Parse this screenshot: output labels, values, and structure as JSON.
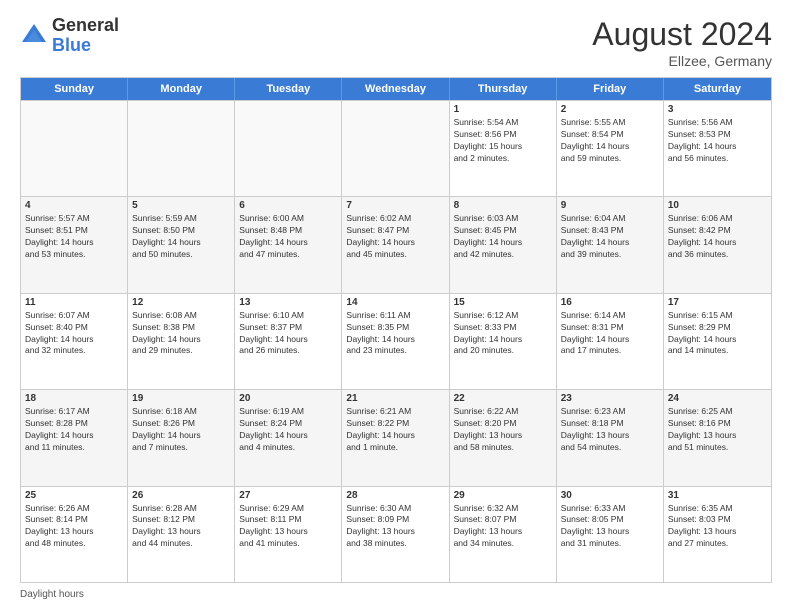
{
  "logo": {
    "general": "General",
    "blue": "Blue"
  },
  "title": "August 2024",
  "location": "Ellzee, Germany",
  "footer": "Daylight hours",
  "days_of_week": [
    "Sunday",
    "Monday",
    "Tuesday",
    "Wednesday",
    "Thursday",
    "Friday",
    "Saturday"
  ],
  "weeks": [
    [
      {
        "num": "",
        "info": ""
      },
      {
        "num": "",
        "info": ""
      },
      {
        "num": "",
        "info": ""
      },
      {
        "num": "",
        "info": ""
      },
      {
        "num": "1",
        "info": "Sunrise: 5:54 AM\nSunset: 8:56 PM\nDaylight: 15 hours\nand 2 minutes."
      },
      {
        "num": "2",
        "info": "Sunrise: 5:55 AM\nSunset: 8:54 PM\nDaylight: 14 hours\nand 59 minutes."
      },
      {
        "num": "3",
        "info": "Sunrise: 5:56 AM\nSunset: 8:53 PM\nDaylight: 14 hours\nand 56 minutes."
      }
    ],
    [
      {
        "num": "4",
        "info": "Sunrise: 5:57 AM\nSunset: 8:51 PM\nDaylight: 14 hours\nand 53 minutes."
      },
      {
        "num": "5",
        "info": "Sunrise: 5:59 AM\nSunset: 8:50 PM\nDaylight: 14 hours\nand 50 minutes."
      },
      {
        "num": "6",
        "info": "Sunrise: 6:00 AM\nSunset: 8:48 PM\nDaylight: 14 hours\nand 47 minutes."
      },
      {
        "num": "7",
        "info": "Sunrise: 6:02 AM\nSunset: 8:47 PM\nDaylight: 14 hours\nand 45 minutes."
      },
      {
        "num": "8",
        "info": "Sunrise: 6:03 AM\nSunset: 8:45 PM\nDaylight: 14 hours\nand 42 minutes."
      },
      {
        "num": "9",
        "info": "Sunrise: 6:04 AM\nSunset: 8:43 PM\nDaylight: 14 hours\nand 39 minutes."
      },
      {
        "num": "10",
        "info": "Sunrise: 6:06 AM\nSunset: 8:42 PM\nDaylight: 14 hours\nand 36 minutes."
      }
    ],
    [
      {
        "num": "11",
        "info": "Sunrise: 6:07 AM\nSunset: 8:40 PM\nDaylight: 14 hours\nand 32 minutes."
      },
      {
        "num": "12",
        "info": "Sunrise: 6:08 AM\nSunset: 8:38 PM\nDaylight: 14 hours\nand 29 minutes."
      },
      {
        "num": "13",
        "info": "Sunrise: 6:10 AM\nSunset: 8:37 PM\nDaylight: 14 hours\nand 26 minutes."
      },
      {
        "num": "14",
        "info": "Sunrise: 6:11 AM\nSunset: 8:35 PM\nDaylight: 14 hours\nand 23 minutes."
      },
      {
        "num": "15",
        "info": "Sunrise: 6:12 AM\nSunset: 8:33 PM\nDaylight: 14 hours\nand 20 minutes."
      },
      {
        "num": "16",
        "info": "Sunrise: 6:14 AM\nSunset: 8:31 PM\nDaylight: 14 hours\nand 17 minutes."
      },
      {
        "num": "17",
        "info": "Sunrise: 6:15 AM\nSunset: 8:29 PM\nDaylight: 14 hours\nand 14 minutes."
      }
    ],
    [
      {
        "num": "18",
        "info": "Sunrise: 6:17 AM\nSunset: 8:28 PM\nDaylight: 14 hours\nand 11 minutes."
      },
      {
        "num": "19",
        "info": "Sunrise: 6:18 AM\nSunset: 8:26 PM\nDaylight: 14 hours\nand 7 minutes."
      },
      {
        "num": "20",
        "info": "Sunrise: 6:19 AM\nSunset: 8:24 PM\nDaylight: 14 hours\nand 4 minutes."
      },
      {
        "num": "21",
        "info": "Sunrise: 6:21 AM\nSunset: 8:22 PM\nDaylight: 14 hours\nand 1 minute."
      },
      {
        "num": "22",
        "info": "Sunrise: 6:22 AM\nSunset: 8:20 PM\nDaylight: 13 hours\nand 58 minutes."
      },
      {
        "num": "23",
        "info": "Sunrise: 6:23 AM\nSunset: 8:18 PM\nDaylight: 13 hours\nand 54 minutes."
      },
      {
        "num": "24",
        "info": "Sunrise: 6:25 AM\nSunset: 8:16 PM\nDaylight: 13 hours\nand 51 minutes."
      }
    ],
    [
      {
        "num": "25",
        "info": "Sunrise: 6:26 AM\nSunset: 8:14 PM\nDaylight: 13 hours\nand 48 minutes."
      },
      {
        "num": "26",
        "info": "Sunrise: 6:28 AM\nSunset: 8:12 PM\nDaylight: 13 hours\nand 44 minutes."
      },
      {
        "num": "27",
        "info": "Sunrise: 6:29 AM\nSunset: 8:11 PM\nDaylight: 13 hours\nand 41 minutes."
      },
      {
        "num": "28",
        "info": "Sunrise: 6:30 AM\nSunset: 8:09 PM\nDaylight: 13 hours\nand 38 minutes."
      },
      {
        "num": "29",
        "info": "Sunrise: 6:32 AM\nSunset: 8:07 PM\nDaylight: 13 hours\nand 34 minutes."
      },
      {
        "num": "30",
        "info": "Sunrise: 6:33 AM\nSunset: 8:05 PM\nDaylight: 13 hours\nand 31 minutes."
      },
      {
        "num": "31",
        "info": "Sunrise: 6:35 AM\nSunset: 8:03 PM\nDaylight: 13 hours\nand 27 minutes."
      }
    ]
  ]
}
